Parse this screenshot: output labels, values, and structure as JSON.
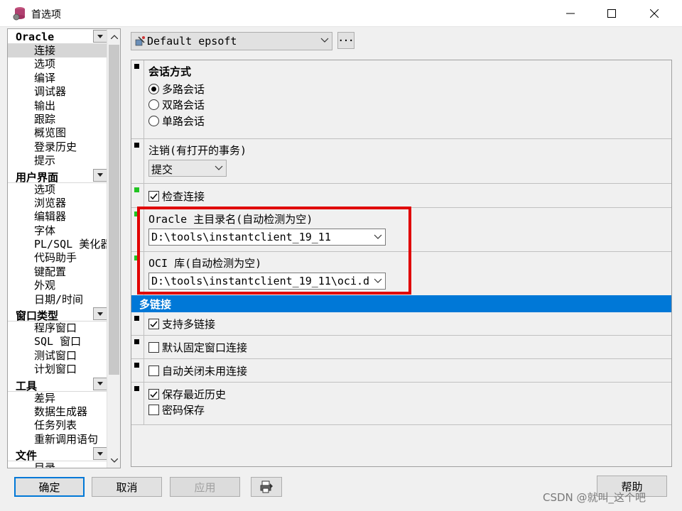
{
  "window": {
    "title": "首选项"
  },
  "nav": {
    "groups": [
      {
        "label": "Oracle",
        "items": [
          "连接",
          "选项",
          "编译",
          "调试器",
          "输出",
          "跟踪",
          "概览图",
          "登录历史",
          "提示"
        ]
      },
      {
        "label": "用户界面",
        "items": [
          "选项",
          "浏览器",
          "编辑器",
          "字体",
          "PL/SQL 美化器",
          "代码助手",
          "键配置",
          "外观",
          "日期/时间"
        ]
      },
      {
        "label": "窗口类型",
        "items": [
          "程序窗口",
          "SQL 窗口",
          "测试窗口",
          "计划窗口"
        ]
      },
      {
        "label": "工具",
        "items": [
          "差异",
          "数据生成器",
          "任务列表",
          "重新调用语句"
        ]
      },
      {
        "label": "文件",
        "items": [
          "目录"
        ]
      }
    ],
    "selected": "连接"
  },
  "profile": {
    "value": "Default epsoft",
    "more_label": "···"
  },
  "sections": {
    "session_mode": {
      "title": "会话方式",
      "options": [
        "多路会话",
        "双路会话",
        "单路会话"
      ],
      "selected_index": 0
    },
    "logoff": {
      "title": "注销(有打开的事务)",
      "value": "提交"
    },
    "check_connection": {
      "label": "检查连接",
      "checked": true
    },
    "oracle_home": {
      "title": "Oracle 主目录名(自动检测为空)",
      "value": "D:\\tools\\instantclient_19_11"
    },
    "oci_library": {
      "title": "OCI 库(自动检测为空)",
      "value": "D:\\tools\\instantclient_19_11\\oci.d"
    },
    "multi_band": {
      "title": "多链接"
    },
    "support_multi": {
      "label": "支持多链接",
      "checked": true
    },
    "default_fixed": {
      "label": "默认固定窗口连接",
      "checked": false
    },
    "auto_close": {
      "label": "自动关闭未用连接",
      "checked": false
    },
    "save_history": {
      "label": "保存最近历史",
      "checked": true
    },
    "save_password": {
      "label": "密码保存",
      "checked": false
    }
  },
  "buttons": {
    "ok": "确定",
    "cancel": "取消",
    "apply": "应用",
    "help": "帮助"
  },
  "watermark": "CSDN @就叫_这个吧",
  "colors": {
    "accent": "#0078d7",
    "highlight": "#e00000",
    "marker_green": "#22c422"
  }
}
